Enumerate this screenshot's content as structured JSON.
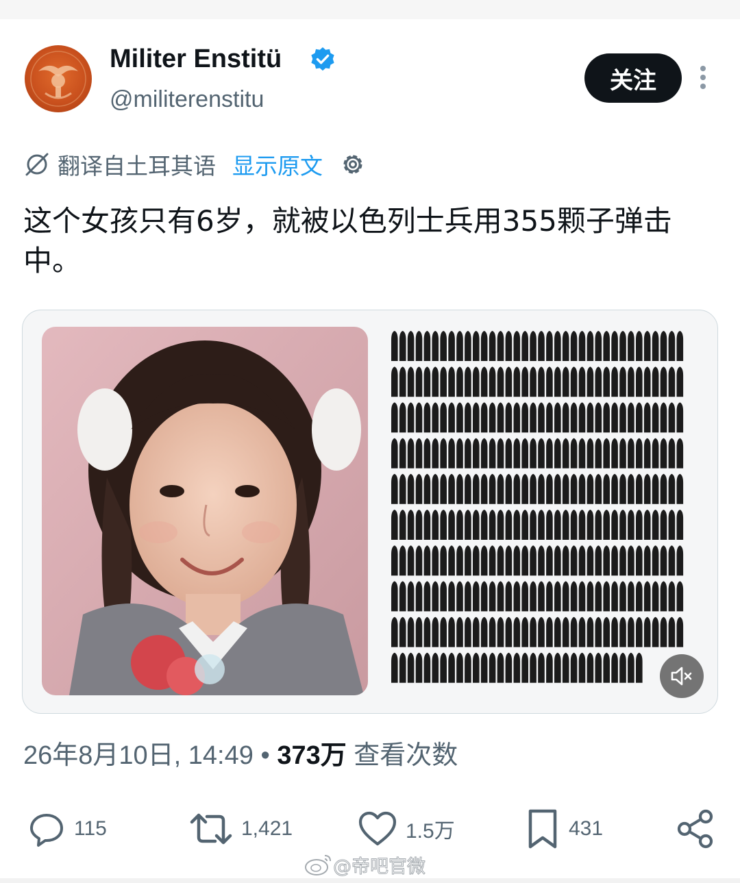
{
  "account": {
    "name": "Militer Enstitü",
    "handle": "@militerenstitu",
    "follow_label": "关注"
  },
  "translation": {
    "label": "翻译自土耳其语",
    "show_original": "显示原文"
  },
  "tweet": {
    "text": "这个女孩只有6岁，就被以色列士兵用355颗子弹击中。"
  },
  "media": {
    "bullet_count": 355,
    "muted": true
  },
  "meta": {
    "date": "26年8月10日, 14:49",
    "separator": " • ",
    "views": "373万",
    "views_label": " 查看次数"
  },
  "actions": {
    "replies": "115",
    "reposts": "1,421",
    "likes": "1.5万",
    "bookmarks": "431"
  },
  "watermark": "@帝吧官微",
  "colors": {
    "accent": "#1d9bf0",
    "text": "#0f1419",
    "secondary": "#536471",
    "button_bg": "#0f1419"
  },
  "icons": [
    "verified-badge-icon",
    "more-options-icon",
    "translate-icon",
    "gear-icon",
    "mute-icon",
    "reply-icon",
    "repost-icon",
    "like-icon",
    "bookmark-icon",
    "share-icon",
    "weibo-icon"
  ]
}
